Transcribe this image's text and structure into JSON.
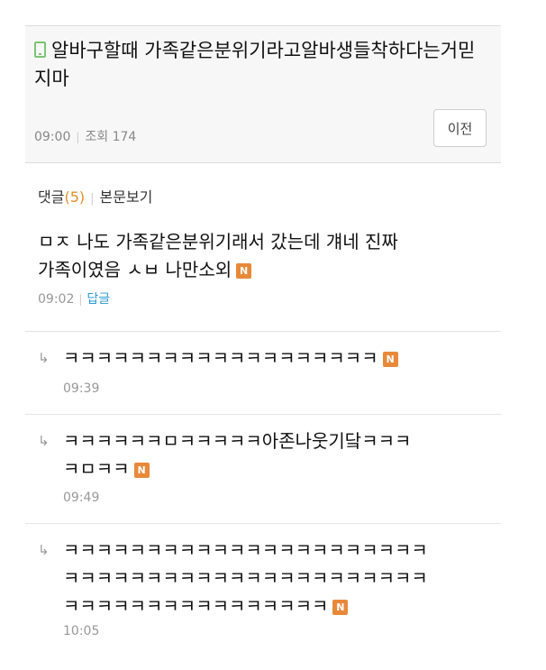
{
  "post": {
    "title": "알바구할때 가족같은분위기라고알바생들착하다는거믿지마",
    "time": "09:00",
    "views": "조회 174",
    "prev_label": "이전"
  },
  "comments_bar": {
    "label": "댓글",
    "count": "(5)",
    "view_body": "본문보기"
  },
  "comments": [
    {
      "line1": "ㅁㅈ 나도 가족같은분위기래서 갔는데 걔네 진짜",
      "line2": "가족이였음 ㅅㅂ 나만소외",
      "badge": "N",
      "time": "09:02",
      "reply": "답글"
    },
    {
      "line1": "ㅋㅋㅋㅋㅋㅋㅋㅋㅋㅋㅋㅋㅋㅋㅋㅋㅋㅋㅋ",
      "badge": "N",
      "time": "09:39"
    },
    {
      "line1": "ㅋㅋㅋㅋㅋㅋㅁㅋㅋㅋㅋㅋ아존나웃기닼ㅋㅋㅋ",
      "line2": "ㅋㅁㅋㅋ",
      "badge": "N",
      "time": "09:49"
    },
    {
      "line1": "ㅋㅋㅋㅋㅋㅋㅋㅋㅋㅋㅋㅋㅋㅋㅋㅋㅋㅋㅋㅋㅋㅋ",
      "line2": "ㅋㅋㅋㅋㅋㅋㅋㅋㅋㅋㅋㅋㅋㅋㅋㅋㅋㅋㅋㅋㅋㅋ",
      "line3": "ㅋㅋㅋㅋㅋㅋㅋㅋㅋㅋㅋㅋㅋㅋㅋㅋ",
      "badge": "N",
      "time": "10:05"
    }
  ],
  "colors": {
    "badge": "#e8893a",
    "reply_link": "#2f9bd1",
    "count": "#e0902a",
    "phone_icon": "#7cc576"
  }
}
